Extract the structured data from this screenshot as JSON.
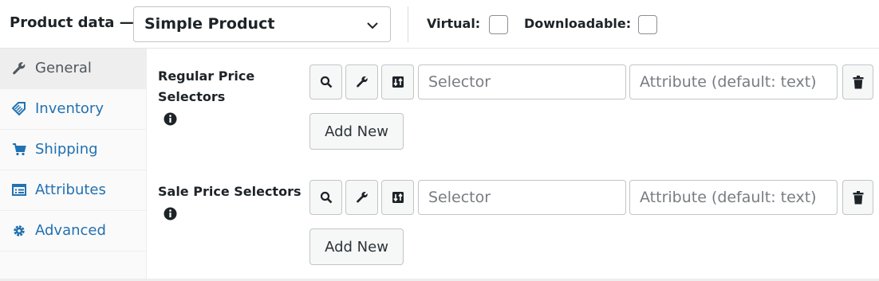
{
  "header": {
    "title": "Product data —",
    "product_type": {
      "selected": "Simple Product",
      "icon": "chevron-down-icon"
    },
    "options": {
      "virtual_label": "Virtual:",
      "virtual_checked": false,
      "downloadable_label": "Downloadable:",
      "downloadable_checked": false
    }
  },
  "sidebar": {
    "items": [
      {
        "label": "General",
        "icon": "wrench-icon",
        "active": true
      },
      {
        "label": "Inventory",
        "icon": "tag-icon",
        "active": false
      },
      {
        "label": "Shipping",
        "icon": "cart-icon",
        "active": false
      },
      {
        "label": "Attributes",
        "icon": "list-icon",
        "active": false
      },
      {
        "label": "Advanced",
        "icon": "gear-icon",
        "active": false
      }
    ]
  },
  "main": {
    "rows": [
      {
        "label_line1": "Regular Price",
        "label_line2": "Selectors",
        "selector_placeholder": "Selector",
        "attribute_placeholder": "Attribute (default: text)",
        "add_label": "Add New"
      },
      {
        "label_line1": "Sale Price Selectors",
        "label_line2": "",
        "selector_placeholder": "Selector",
        "attribute_placeholder": "Attribute (default: text)",
        "add_label": "Add New"
      }
    ]
  },
  "colors": {
    "link": "#2271b1",
    "active_tab_bg": "#eeeeee",
    "sidebar_bg": "#fafafa",
    "text": "#1d2327"
  }
}
